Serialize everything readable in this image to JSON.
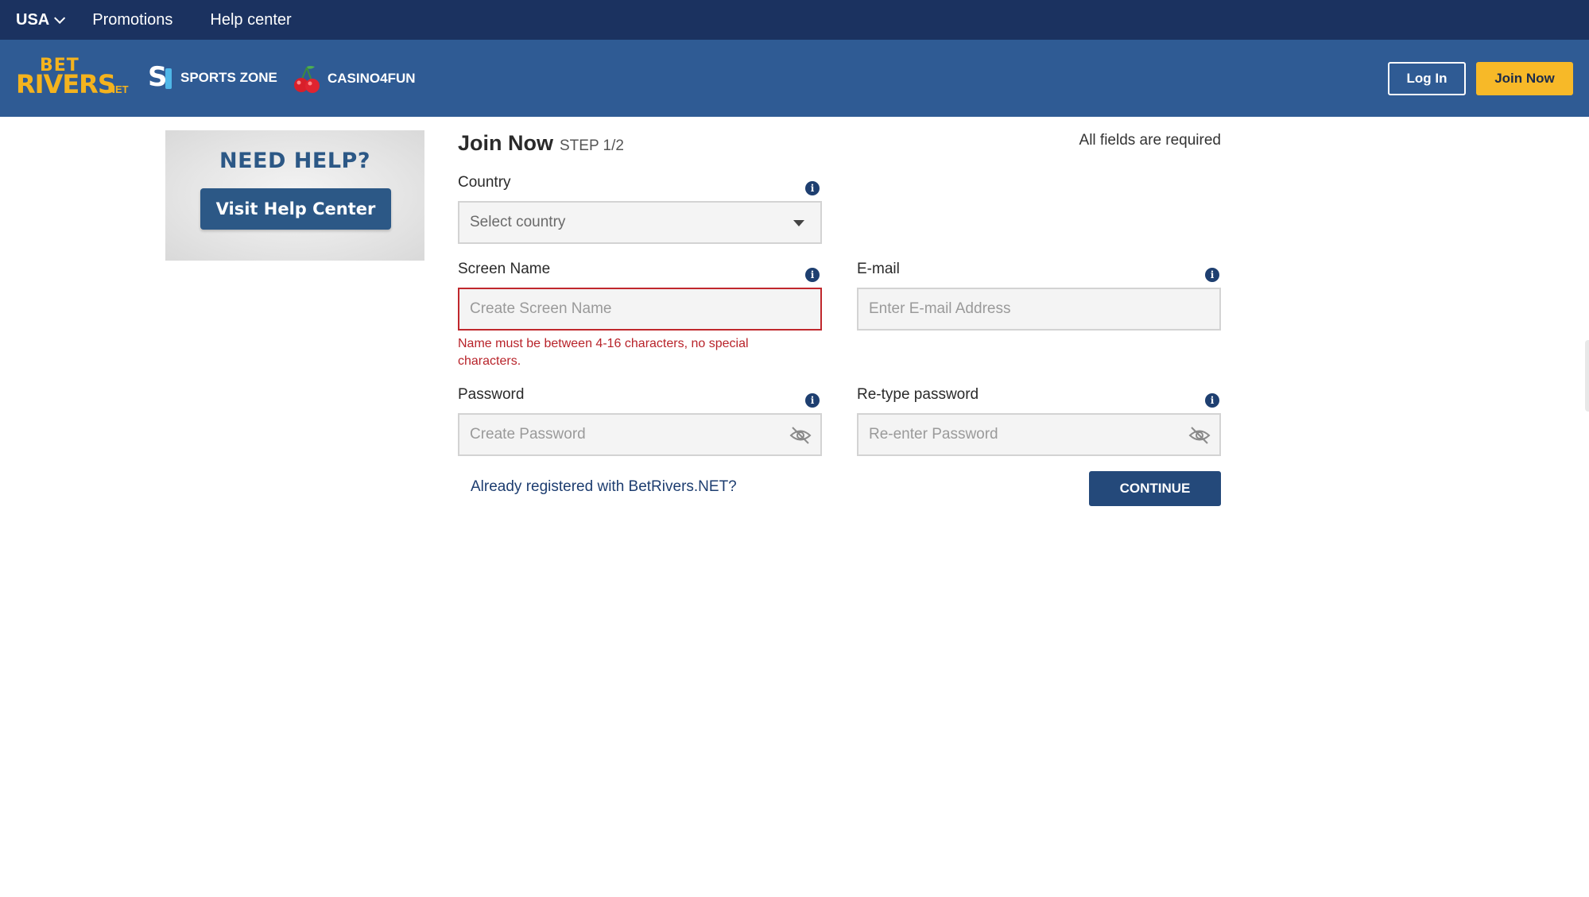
{
  "topbar": {
    "region": "USA",
    "links": [
      "Promotions",
      "Help center"
    ]
  },
  "header": {
    "logo": {
      "line1": "BET",
      "line2": "RIVERS",
      "suffix": ".NET"
    },
    "nav": {
      "sports": "SPORTS ZONE",
      "casino": "CASINO4FUN"
    },
    "login_label": "Log In",
    "join_label": "Join Now"
  },
  "help": {
    "title": "NEED HELP?",
    "button_label": "Visit Help Center"
  },
  "form": {
    "title": "Join Now",
    "step": "STEP 1/2",
    "required_note": "All fields are required",
    "country": {
      "label": "Country",
      "placeholder": "Select country"
    },
    "screen_name": {
      "label": "Screen Name",
      "placeholder": "Create Screen Name",
      "error": "Name must be between 4-16 characters, no special characters."
    },
    "email": {
      "label": "E-mail",
      "placeholder": "Enter E-mail Address"
    },
    "password": {
      "label": "Password",
      "placeholder": "Create Password"
    },
    "retype_password": {
      "label": "Re-type password",
      "placeholder": "Re-enter Password"
    },
    "registered_link": "Already registered with BetRivers.NET?",
    "continue_label": "CONTINUE",
    "info_glyph": "i"
  },
  "colors": {
    "topbar": "#1b3260",
    "header": "#2f5b94",
    "accent_yellow": "#f7b928",
    "error": "#c0282d",
    "primary_button": "#24497a"
  }
}
